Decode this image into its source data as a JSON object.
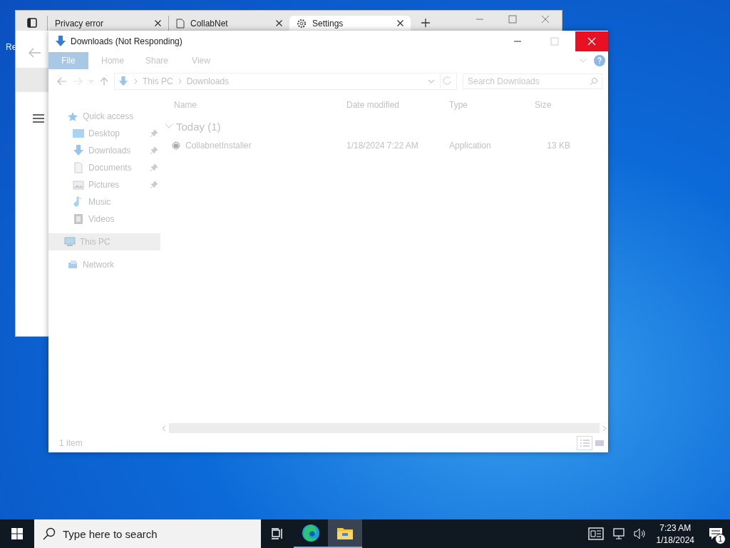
{
  "desktop": {
    "icon_label": "Re"
  },
  "browser": {
    "tabs": [
      {
        "label": "Privacy error",
        "kind": "none",
        "selected": false
      },
      {
        "label": "CollabNet",
        "kind": "page",
        "selected": false
      },
      {
        "label": "Settings",
        "kind": "gear",
        "selected": true
      }
    ]
  },
  "explorer": {
    "title": "Downloads (Not Responding)",
    "ribbon_tabs": [
      {
        "label": "File",
        "selected": true
      },
      {
        "label": "Home",
        "selected": false
      },
      {
        "label": "Share",
        "selected": false
      },
      {
        "label": "View",
        "selected": false
      }
    ],
    "breadcrumb": [
      "This PC",
      "Downloads"
    ],
    "search": {
      "placeholder": "Search Downloads"
    },
    "nav": [
      {
        "label": "Quick access",
        "kind": "star",
        "selected": false,
        "children": [
          {
            "label": "Desktop",
            "kind": "desktop",
            "pinned": true,
            "selected": false
          },
          {
            "label": "Downloads",
            "kind": "download",
            "pinned": true,
            "selected": false
          },
          {
            "label": "Documents",
            "kind": "document",
            "pinned": true,
            "selected": false
          },
          {
            "label": "Pictures",
            "kind": "pictures",
            "pinned": true,
            "selected": false
          },
          {
            "label": "Music",
            "kind": "music",
            "pinned": false,
            "selected": false
          },
          {
            "label": "Videos",
            "kind": "videos",
            "pinned": false,
            "selected": false
          }
        ]
      },
      {
        "label": "This PC",
        "kind": "pc",
        "selected": true
      },
      {
        "label": "Network",
        "kind": "network",
        "selected": false
      }
    ],
    "columns": [
      "Name",
      "Date modified",
      "Type",
      "Size"
    ],
    "groups": [
      {
        "label": "Today (1)",
        "expanded": true,
        "rows": [
          {
            "name": "CollabnetInstaller",
            "date": "1/18/2024 7:22 AM",
            "type": "Application",
            "size": "13 KB"
          }
        ]
      }
    ],
    "status": "1 item"
  },
  "taskbar": {
    "search_placeholder": "Type here to search",
    "apps": [
      {
        "kind": "edge",
        "selected": false
      },
      {
        "kind": "explorer",
        "selected": true
      }
    ],
    "time": "7:23 AM",
    "date": "1/18/2024",
    "notification_count": "1"
  }
}
